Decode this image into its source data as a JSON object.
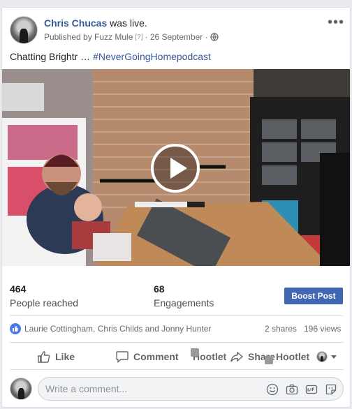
{
  "post": {
    "author": "Chris Chucas",
    "action": "was live.",
    "published_prefix": "Published by Fuzz Mule",
    "help_marker": "[?]",
    "date_sep": "· 26 September ·",
    "more_label": "•••",
    "text": "Chatting Brightr …",
    "hashtag": "#NeverGoingHomepodcast"
  },
  "stats": {
    "reached_value": "464",
    "reached_label": "People reached",
    "engagements_value": "68",
    "engagements_label": "Engagements",
    "boost_label": "Boost Post"
  },
  "reactions": {
    "names": "Laurie Cottingham, Chris Childs and Jonny Hunter",
    "shares": "2 shares",
    "views": "196 views"
  },
  "actions": {
    "like": "Like",
    "comment": "Comment",
    "hootlet1": "Hootlet",
    "share": "Share",
    "hootlet2": "Hootlet"
  },
  "comment": {
    "placeholder": "Write a comment..."
  },
  "colors": {
    "link": "#365899",
    "boost": "#4267b2",
    "like_badge": "#4a7ae8"
  }
}
